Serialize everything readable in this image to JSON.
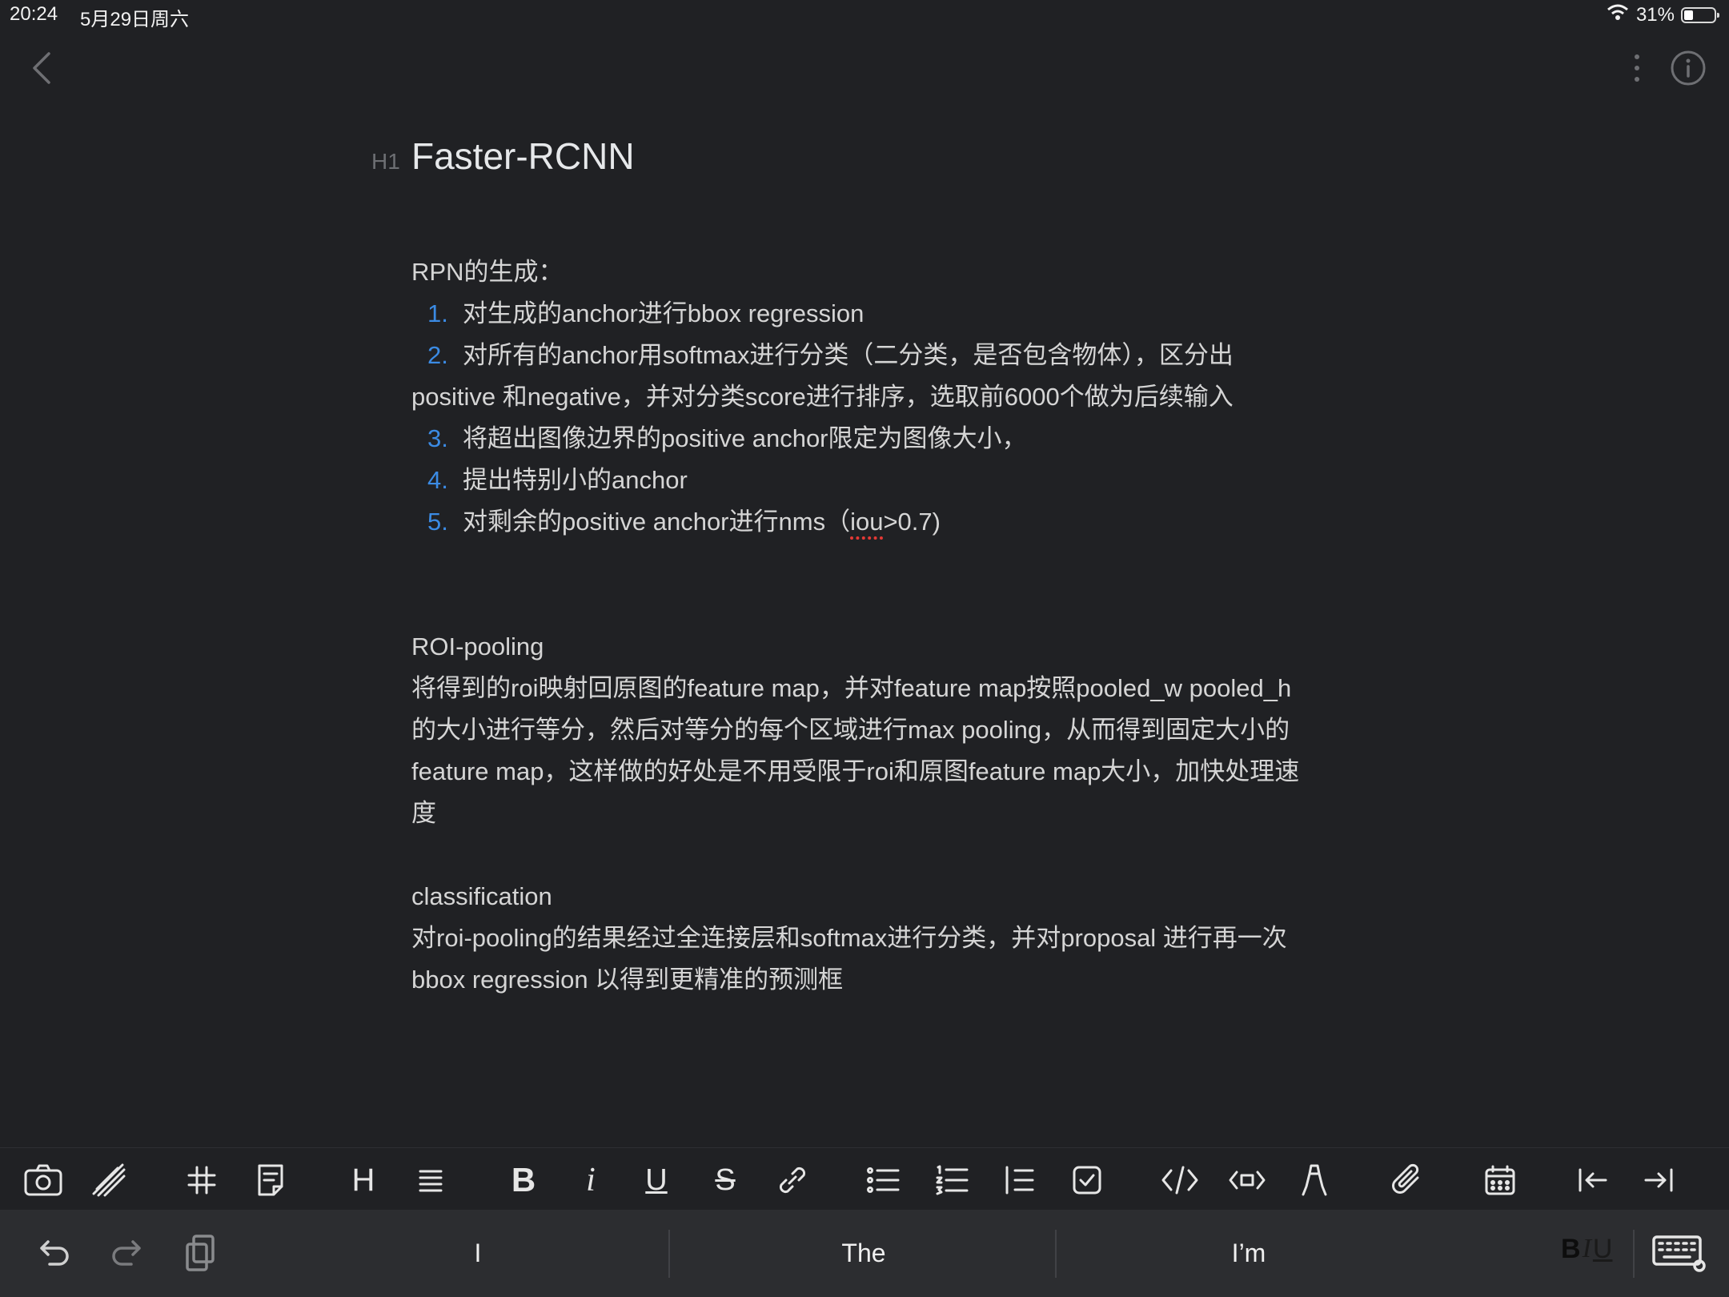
{
  "status_bar": {
    "time": "20:24",
    "date": "5月29日周六",
    "battery": "31%",
    "battery_level": 0.31
  },
  "document": {
    "heading_marker": "H1",
    "title": "Faster-RCNN",
    "sections": {
      "rpn_title": "RPN的生成：",
      "rpn_items": [
        {
          "num": "1.",
          "text": "对生成的anchor进行bbox regression"
        },
        {
          "num": "2.",
          "text": "对所有的anchor用softmax进行分类（二分类，是否包含物体），区分出positive 和negative，并对分类score进行排序，选取前6000个做为后续输入"
        },
        {
          "num": "3.",
          "text": "将超出图像边界的positive anchor限定为图像大小，"
        },
        {
          "num": "4.",
          "text": "提出特别小的anchor"
        },
        {
          "num": "5.",
          "text_before": "对剩余的positive anchor进行nms（",
          "text_flagged": "iou",
          "text_after": ">0.7)"
        }
      ],
      "roi_title": "ROI-pooling",
      "roi_body": "将得到的roi映射回原图的feature map，并对feature map按照pooled_w pooled_h的大小进行等分，然后对等分的每个区域进行max pooling，从而得到固定大小的feature map，这样做的好处是不用受限于roi和原图feature map大小，加快处理速度",
      "cls_title": "classification",
      "cls_body": "对roi-pooling的结果经过全连接层和softmax进行分类，并对proposal 进行再一次bbox regression 以得到更精准的预测框"
    }
  },
  "format_toolbar": {
    "heading_label": "H",
    "bold_label": "B",
    "italic_label": "i",
    "underline_label": "U",
    "strike_label": "S"
  },
  "keyboard_bar": {
    "suggestions": [
      "I",
      "The",
      "I’m"
    ],
    "biu": {
      "b": "B",
      "i": "I",
      "u": "U"
    }
  }
}
